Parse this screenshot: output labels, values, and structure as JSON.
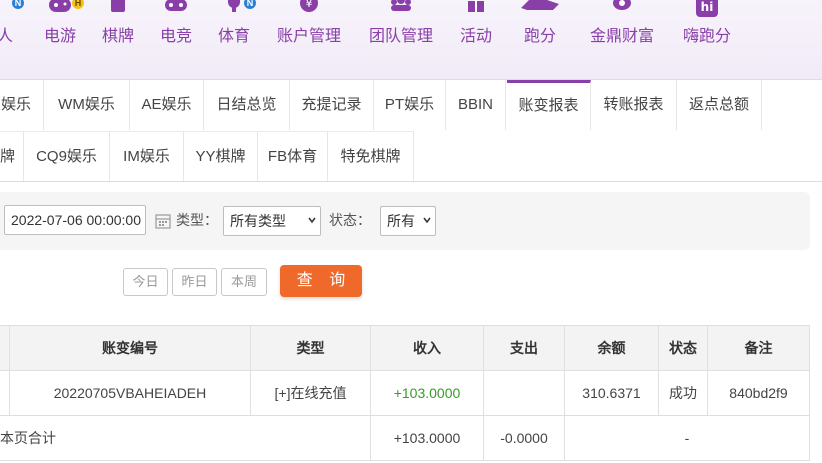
{
  "nav": {
    "items": [
      {
        "label": "人",
        "badge": "N",
        "icon": "person-icon"
      },
      {
        "label": "电游",
        "badge": "H",
        "icon": "gamepad-icon"
      },
      {
        "label": "棋牌",
        "icon": "cards-icon"
      },
      {
        "label": "电竞",
        "icon": "controller-icon"
      },
      {
        "label": "体育",
        "badge": "N",
        "icon": "trophy-icon"
      },
      {
        "label": "账户管理",
        "icon": "yen-coin-icon"
      },
      {
        "label": "团队管理",
        "icon": "team-icon"
      },
      {
        "label": "活动",
        "icon": "gift-icon"
      },
      {
        "label": "跑分",
        "icon": "running-rhino-icon"
      },
      {
        "label": "金鼎财富",
        "icon": "treasure-icon"
      },
      {
        "label": "嗨跑分",
        "icon": "hi-logo-icon"
      }
    ],
    "accent": "#8a3fa8"
  },
  "tabs": {
    "row1": [
      "娱乐",
      "WM娱乐",
      "AE娱乐",
      "日结总览",
      "充提记录",
      "PT娱乐",
      "BBIN",
      "账变报表",
      "转账报表",
      "返点总额"
    ],
    "row2": [
      "牌",
      "CQ9娱乐",
      "IM娱乐",
      "YY棋牌",
      "FB体育",
      "特免棋牌"
    ],
    "active": "账变报表"
  },
  "filter": {
    "date_value": "2022-07-06 00:00:00",
    "type_label": "类型：",
    "type_value": "所有类型",
    "status_label": "状态：",
    "status_value": "所有",
    "btn_today": "今日",
    "btn_yesterday": "昨日",
    "btn_week": "本周",
    "btn_search": "查 询",
    "search_color": "#ef6a2a"
  },
  "table": {
    "headers": [
      "",
      "账变编号",
      "类型",
      "收入",
      "支出",
      "余额",
      "状态",
      "备注"
    ],
    "row": {
      "id": "20220705VBAHEIADEH",
      "type": "[+]在线充值",
      "income": "+103.0000",
      "expense": "",
      "balance": "310.6371",
      "status": "成功",
      "note": "840bd2f9"
    },
    "summary": {
      "label": "本页合计",
      "income": "+103.0000",
      "expense": "-0.0000",
      "dash": "-"
    }
  }
}
